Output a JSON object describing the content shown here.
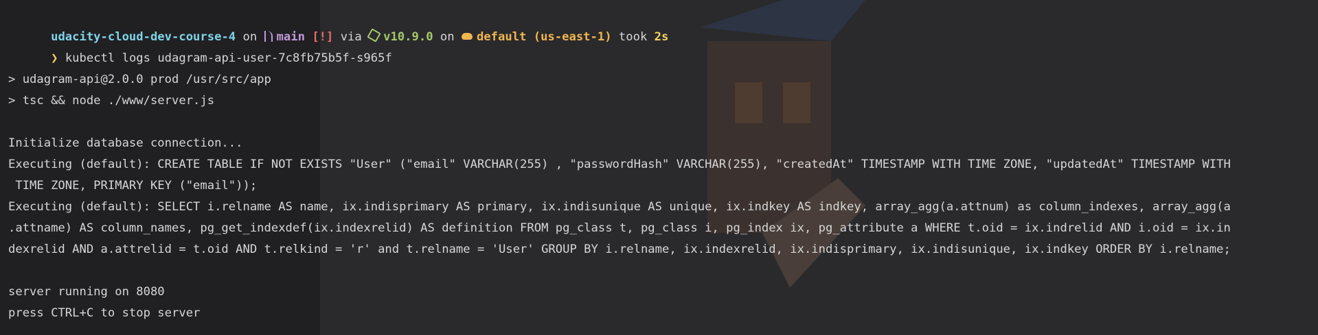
{
  "prompt": {
    "directory": "udacity-cloud-dev-course-4",
    "on1": " on ",
    "branch": "main",
    "status": "[!]",
    "via": " via ",
    "node_version": "v10.9.0",
    "on2": " on ",
    "aws_profile": "default (us-east-1)",
    "took": " took ",
    "duration": "2s",
    "arrow": "❯",
    "command": "kubectl logs udagram-api-user-7c8fb75b5f-s965f"
  },
  "output": [
    "",
    "> udagram-api@2.0.0 prod /usr/src/app",
    "> tsc && node ./www/server.js",
    "",
    "Initialize database connection...",
    "Executing (default): CREATE TABLE IF NOT EXISTS \"User\" (\"email\" VARCHAR(255) , \"passwordHash\" VARCHAR(255), \"createdAt\" TIMESTAMP WITH TIME ZONE, \"updatedAt\" TIMESTAMP WITH",
    " TIME ZONE, PRIMARY KEY (\"email\"));",
    "Executing (default): SELECT i.relname AS name, ix.indisprimary AS primary, ix.indisunique AS unique, ix.indkey AS indkey, array_agg(a.attnum) as column_indexes, array_agg(a",
    ".attname) AS column_names, pg_get_indexdef(ix.indexrelid) AS definition FROM pg_class t, pg_class i, pg_index ix, pg_attribute a WHERE t.oid = ix.indrelid AND i.oid = ix.in",
    "dexrelid AND a.attrelid = t.oid AND t.relkind = 'r' and t.relname = 'User' GROUP BY i.relname, ix.indexrelid, ix.indisprimary, ix.indisunique, ix.indkey ORDER BY i.relname;",
    "",
    "server running on 8080",
    "press CTRL+C to stop server"
  ],
  "icons": {
    "branch": "git-branch-icon",
    "node": "nodejs-hexagon-icon",
    "aws": "cloud-icon"
  },
  "colors": {
    "background": "#2a2a2c",
    "text": "#d6d6d6",
    "directory": "#7fd3e8",
    "branch": "#c19ad8",
    "status": "#e86b6b",
    "node": "#a4c96b",
    "aws": "#f0b54e",
    "duration": "#f0d35e"
  }
}
